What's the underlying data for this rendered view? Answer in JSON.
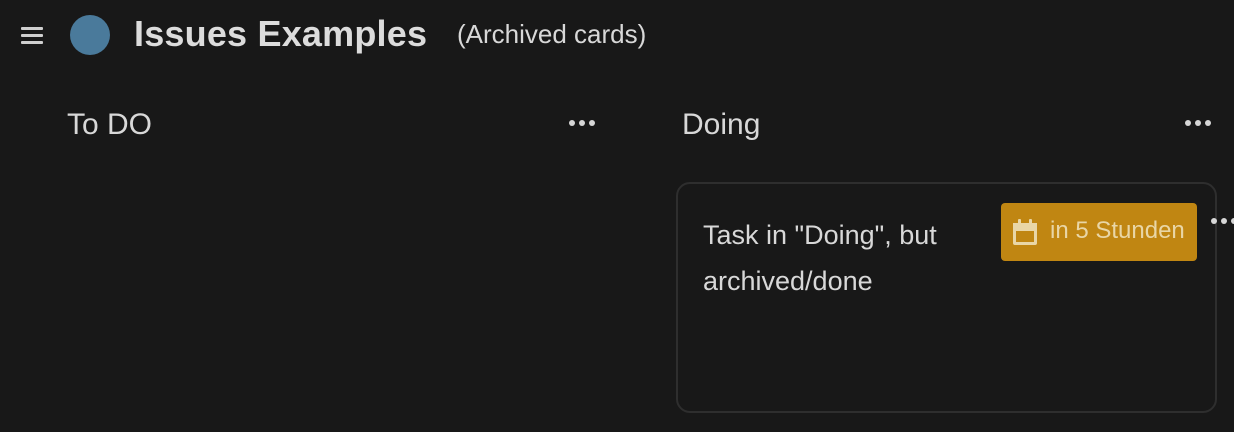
{
  "header": {
    "board_title": "Issues Examples",
    "board_subtitle": "(Archived cards)",
    "board_color": "#4a7a9b"
  },
  "stacks": [
    {
      "title": "To DO",
      "cards": []
    },
    {
      "title": "Doing",
      "cards": [
        {
          "title": "Task in \"Doing\", but archived/done",
          "due_label": "in 5 Stunden",
          "due_color": "#c08612"
        }
      ]
    }
  ]
}
